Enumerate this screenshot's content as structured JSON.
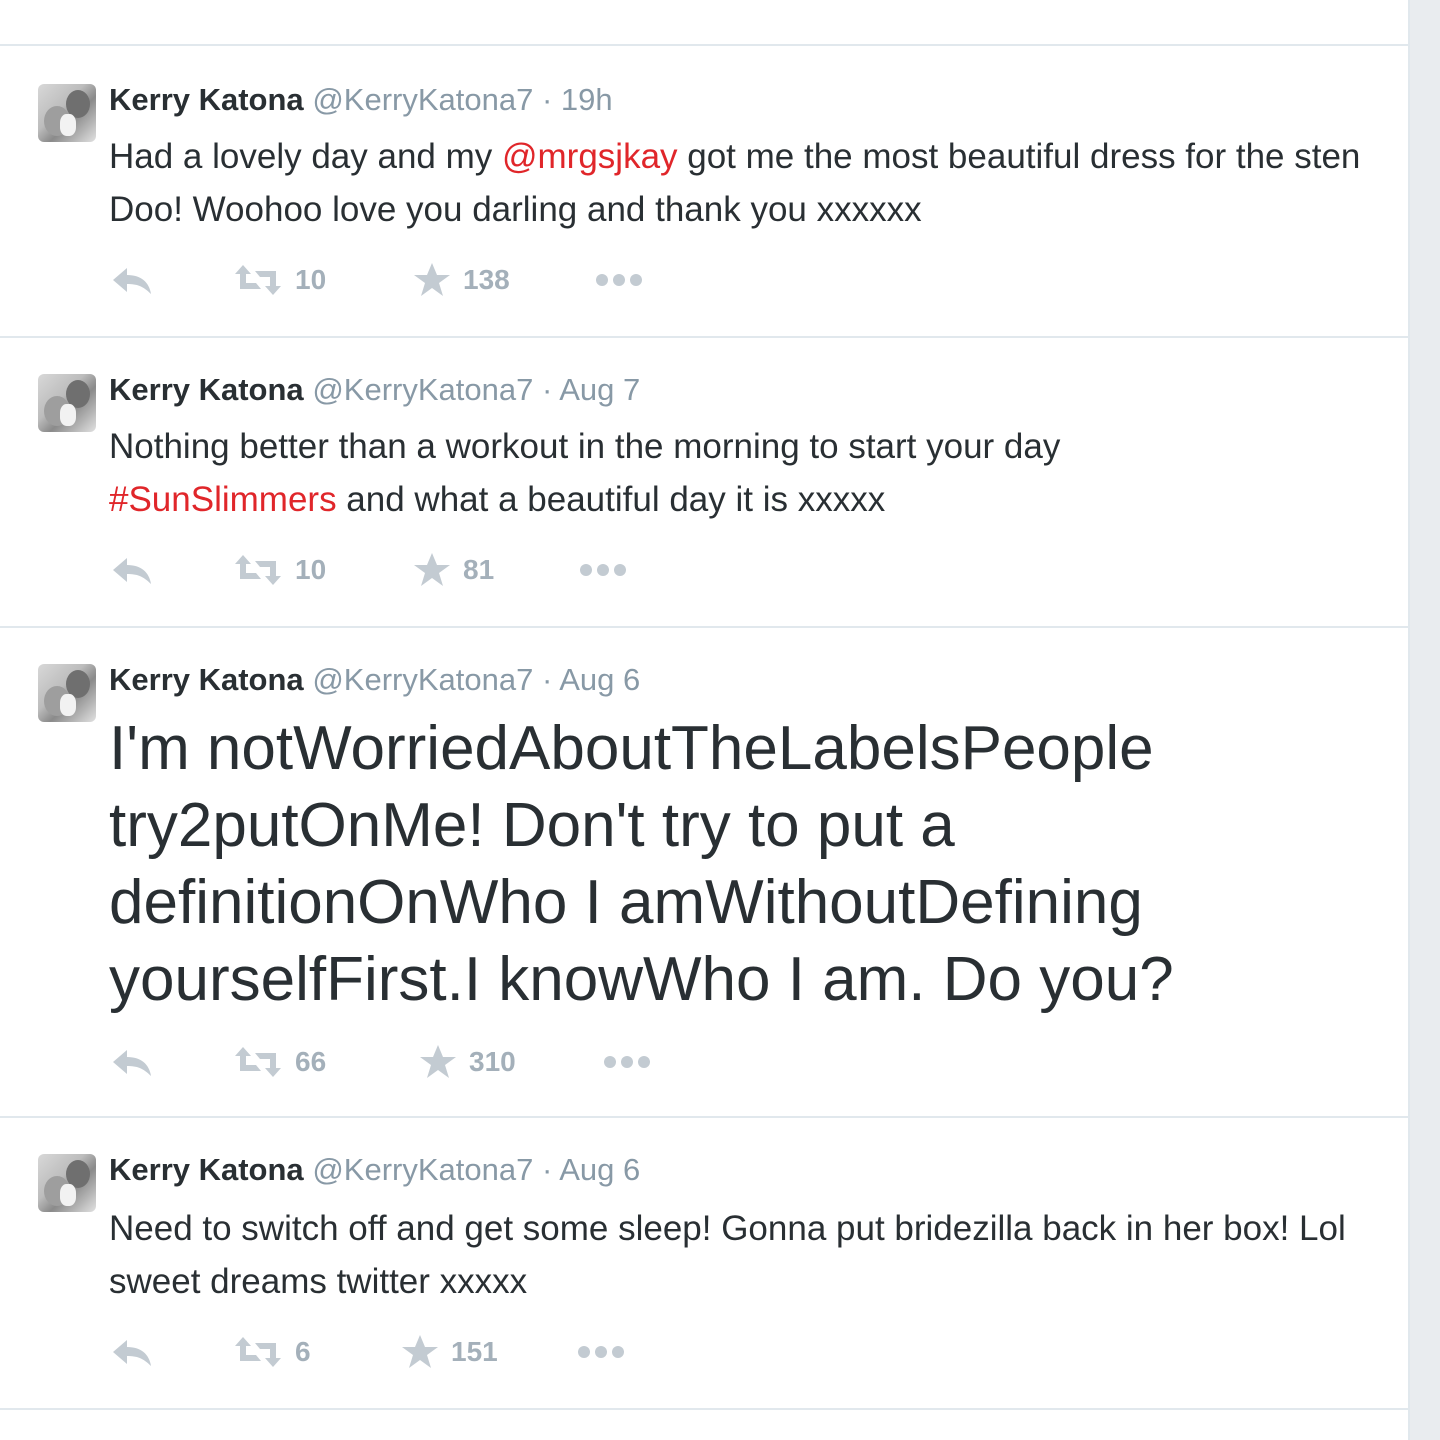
{
  "colors": {
    "accent": "#e0262a",
    "muted": "#8899a6",
    "text": "#292f33",
    "divider": "#e1e8ed"
  },
  "icons": {
    "reply": "reply-arrow-icon",
    "retweet": "retweet-icon",
    "favorite": "star-icon",
    "more": "more-dots-icon"
  },
  "tweets": [
    {
      "name": "Kerry Katona",
      "handle": "@KerryKatona7",
      "separator": "·",
      "time": "19h",
      "text_before": "Had a lovely day and my ",
      "link": "@mrgsjkay",
      "text_after": " got me the most beautiful dress for the sten Doo! Woohoo love you darling and thank you xxxxxx",
      "retweets": "10",
      "favorites": "138"
    },
    {
      "name": "Kerry Katona",
      "handle": "@KerryKatona7",
      "separator": "·",
      "time": "Aug 7",
      "text_before": "Nothing better than a workout in the morning to start your day ",
      "link": "#SunSlimmers",
      "text_after": " and what a beautiful day it is xxxxx",
      "retweets": "10",
      "favorites": "81"
    },
    {
      "name": "Kerry Katona",
      "handle": "@KerryKatona7",
      "separator": "·",
      "time": "Aug 6",
      "text": "I'm notWorriedAboutTheLabelsPeople try2putOnMe! Don't try to put a definitionOnWho I amWithoutDefining yourselfFirst.I knowWho I am. Do you?",
      "retweets": "66",
      "favorites": "310"
    },
    {
      "name": "Kerry Katona",
      "handle": "@KerryKatona7",
      "separator": "·",
      "time": "Aug 6",
      "text": "Need to switch off and get some sleep! Gonna put bridezilla back in her box! Lol sweet dreams twitter xxxxx",
      "retweets": "6",
      "favorites": "151"
    }
  ]
}
